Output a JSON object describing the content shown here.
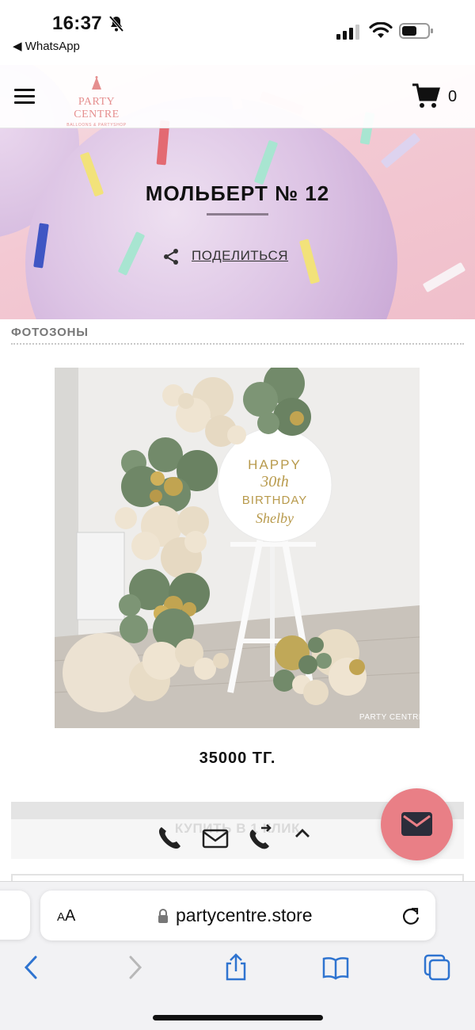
{
  "status_bar": {
    "time": "16:37",
    "back_app": "◀ WhatsApp",
    "icons": [
      "bell-slash-icon",
      "signal-icon",
      "wifi-icon",
      "battery-icon"
    ]
  },
  "header": {
    "logo_name": "PARTY CENTRE",
    "logo_tagline": "BALLOONS & PARTYSHOP",
    "cart_count": "0",
    "icons": [
      "menu-icon",
      "cart-icon"
    ]
  },
  "hero": {
    "title": "МОЛЬБЕРТ № 12",
    "share_label": "ПОДЕЛИТЬСЯ"
  },
  "product": {
    "category": "ФОТОЗОНЫ",
    "photo_sign": {
      "line1": "HAPPY",
      "line2": "30th",
      "line3": "BIRTHDAY",
      "line4": "Shelby"
    },
    "photo_watermark": "PARTY CENTRE",
    "price": "35000 ТГ.",
    "buy_one_click": "КУПИТЬ В 1 КЛИК"
  },
  "contact_bar": {
    "icons": [
      "phone-icon",
      "mail-icon",
      "call-forward-icon",
      "chevron-up-icon"
    ]
  },
  "browser": {
    "text_size_label_small": "A",
    "text_size_label_large": "A",
    "url": "partycentre.store",
    "nav_icons": [
      "back-icon",
      "forward-icon",
      "share-icon",
      "bookmarks-icon",
      "tabs-icon"
    ]
  },
  "colors": {
    "brand_pink": "#e58f8f",
    "fab_pink": "#e97f86",
    "safari_blue": "#2f74d0"
  }
}
